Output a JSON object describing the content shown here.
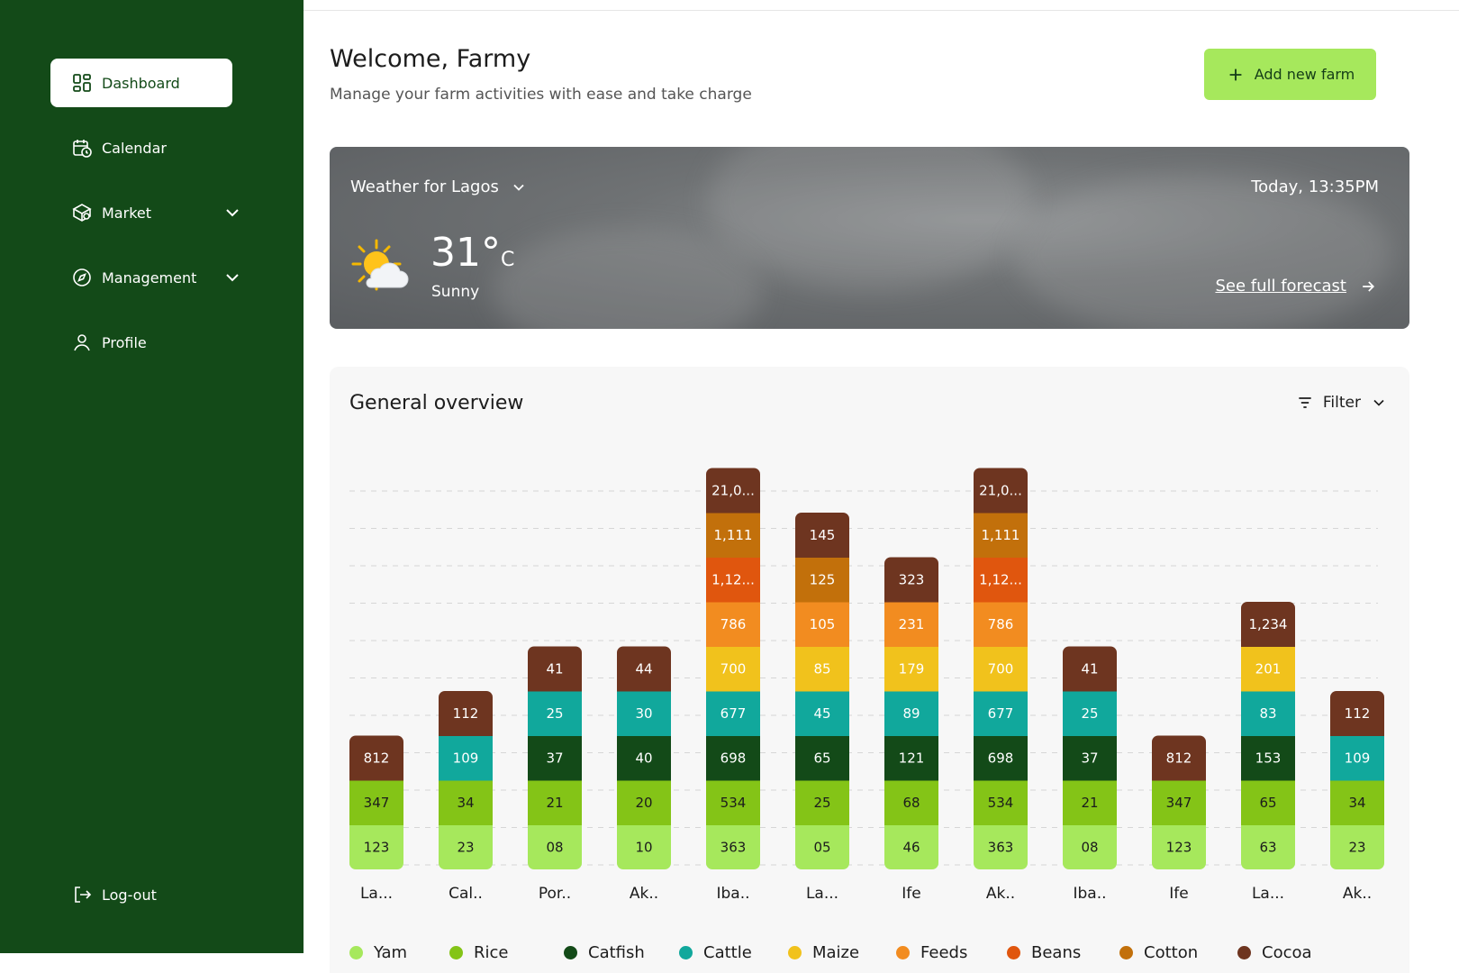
{
  "sidebar": {
    "items": [
      {
        "label": "Dashboard",
        "icon": "dashboard-icon"
      },
      {
        "label": "Calendar",
        "icon": "calendar-icon"
      },
      {
        "label": "Market",
        "icon": "market-icon"
      },
      {
        "label": "Management",
        "icon": "compass-icon"
      },
      {
        "label": "Profile",
        "icon": "user-icon"
      }
    ],
    "logout_label": "Log-out",
    "colors": {
      "background": "#134a18",
      "active_bg": "#ffffff"
    }
  },
  "header": {
    "title": "Welcome, Farmy",
    "subtitle": "Manage your farm activities with ease and take charge",
    "add_button_label": "Add new farm"
  },
  "weather": {
    "location_label": "Weather for Lagos",
    "time": "Today, 13:35PM",
    "temperature": "31°",
    "unit": "C",
    "condition": "Sunny",
    "forecast_link": "See full forecast"
  },
  "overview": {
    "title": "General overview",
    "filter_label": "Filter"
  },
  "chart_data": {
    "type": "bar",
    "stacked": true,
    "categories": [
      "La...",
      "Cal..",
      "Por..",
      "Ak..",
      "Iba..",
      "La...",
      "Ife",
      "Ak..",
      "Iba..",
      "Ife",
      "La...",
      "Ak.."
    ],
    "legend_position": "bottom",
    "grid": true,
    "series": [
      {
        "name": "Yam",
        "color": "#a6e85c",
        "values": [
          "123",
          "23",
          "08",
          "10",
          "363",
          "05",
          "46",
          "363",
          "08",
          "123",
          "63",
          "23"
        ]
      },
      {
        "name": "Rice",
        "color": "#84c417",
        "values": [
          "347",
          "34",
          "21",
          "20",
          "534",
          "25",
          "68",
          "534",
          "21",
          "347",
          "65",
          "34"
        ]
      },
      {
        "name": "Catfish",
        "color": "#134a18",
        "values": [
          null,
          null,
          "37",
          "40",
          "698",
          "65",
          "121",
          "698",
          "37",
          null,
          "153",
          null
        ]
      },
      {
        "name": "Cattle",
        "color": "#11a89c",
        "values": [
          null,
          "109",
          "25",
          "30",
          "677",
          "45",
          "89",
          "677",
          "25",
          null,
          "83",
          "109"
        ]
      },
      {
        "name": "Maize",
        "color": "#f1c21c",
        "values": [
          null,
          null,
          null,
          null,
          "700",
          "85",
          "179",
          "700",
          null,
          null,
          "201",
          null
        ]
      },
      {
        "name": "Feeds",
        "color": "#f28c20",
        "values": [
          null,
          null,
          null,
          null,
          "786",
          "105",
          "231",
          "786",
          null,
          null,
          null,
          null
        ]
      },
      {
        "name": "Beans",
        "color": "#e0560e",
        "values": [
          null,
          null,
          null,
          null,
          "1,12...",
          null,
          null,
          "1,12...",
          null,
          null,
          null,
          null
        ]
      },
      {
        "name": "Cotton",
        "color": "#c2700b",
        "values": [
          null,
          null,
          null,
          null,
          "1,111",
          "125",
          null,
          "1,111",
          null,
          null,
          null,
          null
        ]
      },
      {
        "name": "Cocoa",
        "color": "#6e3520",
        "values": [
          "812",
          "112",
          "41",
          "44",
          "21,0...",
          "145",
          "323",
          "21,0...",
          "41",
          "812",
          "1,234",
          "112"
        ]
      }
    ]
  }
}
